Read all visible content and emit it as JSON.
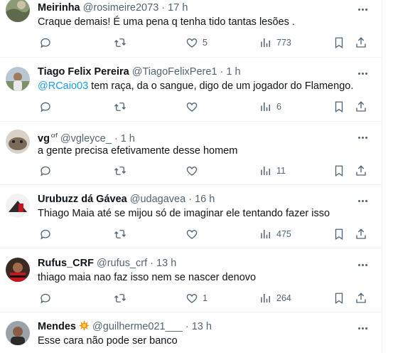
{
  "tweets": [
    {
      "name": "Meirinha",
      "flair": "",
      "handle": "@rosimeire2073",
      "time": "17 h",
      "mention": "",
      "text": "Craque demais! É uma pena q tenha tido tantas lesões .",
      "replies": "",
      "retweets": "",
      "likes": "5",
      "views": "773"
    },
    {
      "name": "Tiago Felix Pereira",
      "flair": "",
      "handle": "@TiagoFelixPere1",
      "time": "1 h",
      "mention": "@RCaio03",
      "text": " tem raça, da o sangue, digo de um jogador do Flamengo.",
      "replies": "",
      "retweets": "",
      "likes": "",
      "views": "6"
    },
    {
      "name": "vg",
      "flair": "crf",
      "handle": "@vgleyce_",
      "time": "1 h",
      "mention": "",
      "text": "a gente precisa efetivamente desse homem",
      "replies": "",
      "retweets": "",
      "likes": "",
      "views": "11"
    },
    {
      "name": "Urubuzz dá Gávea",
      "flair": "",
      "handle": "@udagavea",
      "time": "16 h",
      "mention": "",
      "text": "Thiago Maia até se mijou só de imaginar ele tentando fazer isso",
      "replies": "",
      "retweets": "",
      "likes": "",
      "views": "475"
    },
    {
      "name": "Rufus_CRF",
      "flair": "",
      "handle": "@rufus_crf",
      "time": "13 h",
      "mention": "",
      "text": "thiago maia nao faz isso nem se nascer denovo",
      "replies": "",
      "retweets": "",
      "likes": "1",
      "views": "264"
    },
    {
      "name": "Mendes",
      "flair": "",
      "handle": "@guilherme021___",
      "time": "13 h",
      "mention": "",
      "text": "Esse cara não pode ser banco",
      "replies": "",
      "retweets": "",
      "likes": "",
      "views": ""
    }
  ],
  "separator": "·",
  "colors": {
    "text": "#0f1419",
    "secondary": "#536471",
    "link": "#1d9bf0",
    "border": "#eff3f4"
  },
  "icons": [
    "reply-icon",
    "retweet-icon",
    "like-icon",
    "views-icon",
    "bookmark-icon",
    "share-icon",
    "more-icon",
    "explosion-emoji-icon"
  ]
}
